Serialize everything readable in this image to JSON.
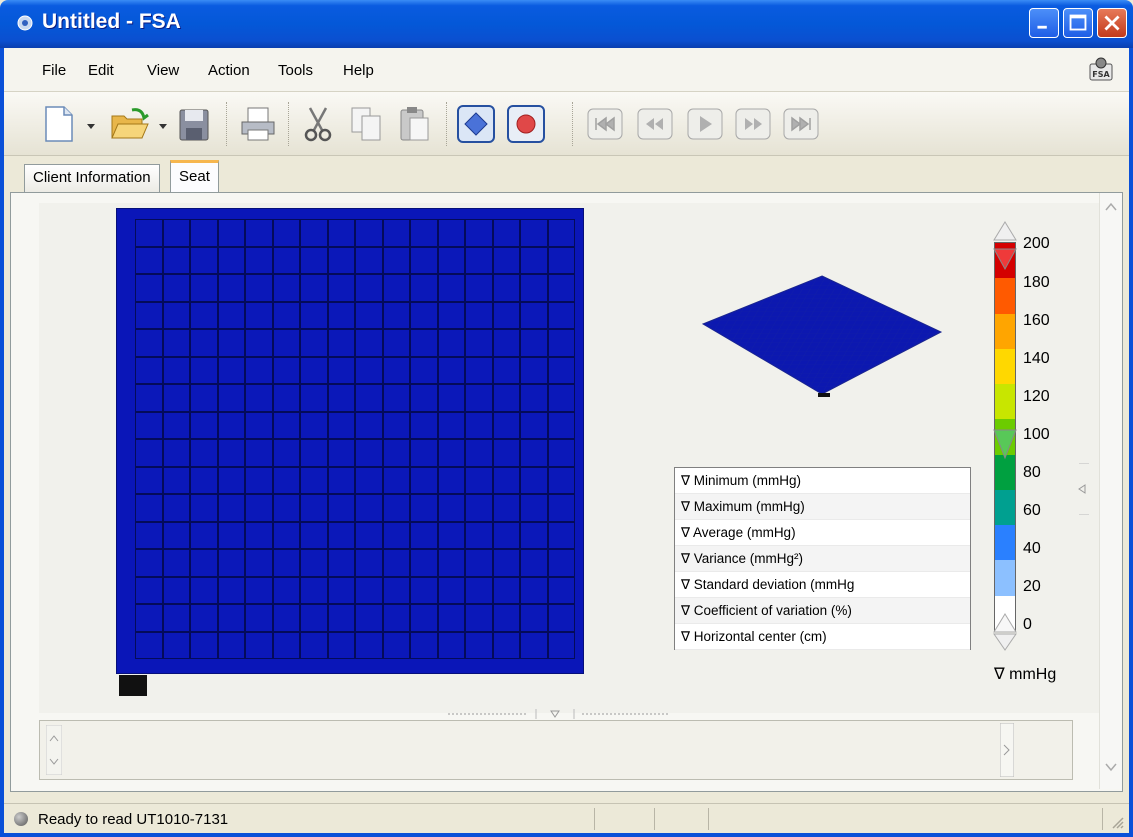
{
  "window": {
    "title": "Untitled - FSA",
    "icon": "fsa-app-icon"
  },
  "menu": {
    "items": [
      "File",
      "Edit",
      "View",
      "Action",
      "Tools",
      "Help"
    ]
  },
  "toolbar": {
    "icons": [
      "new-file-icon",
      "dropdown-arrow-icon",
      "open-folder-icon",
      "dropdown-arrow-icon",
      "save-icon",
      "print-icon",
      "cut-icon",
      "copy-icon",
      "paste-icon",
      "diamond-mode-icon",
      "record-icon",
      "skip-to-start-icon",
      "rewind-icon",
      "play-icon",
      "fast-forward-icon",
      "skip-to-end-icon"
    ]
  },
  "tabs": [
    {
      "label": "Client Information",
      "active": false
    },
    {
      "label": "Seat",
      "active": true
    }
  ],
  "pressure_map": {
    "rows": 16,
    "cols": 16,
    "cell_color": "#0b18b9"
  },
  "stats": {
    "items": [
      "∇ Minimum (mmHg)",
      "∇ Maximum (mmHg)",
      "∇ Average (mmHg)",
      "∇ Variance (mmHg²)",
      "∇ Standard deviation (mmHg",
      "∇ Coefficient of variation (%)",
      "∇ Horizontal center (cm)"
    ]
  },
  "color_scale": {
    "labels": [
      "200",
      "180",
      "160",
      "140",
      "120",
      "100",
      "80",
      "60",
      "40",
      "20",
      "0"
    ],
    "unit": "∇ mmHg",
    "colors": [
      "#d40000",
      "#ff5a00",
      "#ffa500",
      "#ffd800",
      "#c8e600",
      "#6ccc00",
      "#00a040",
      "#00a090",
      "#2a80ff",
      "#8cc0ff",
      "#ffffff"
    ]
  },
  "status": {
    "text": "Ready to read UT1010-7131"
  }
}
